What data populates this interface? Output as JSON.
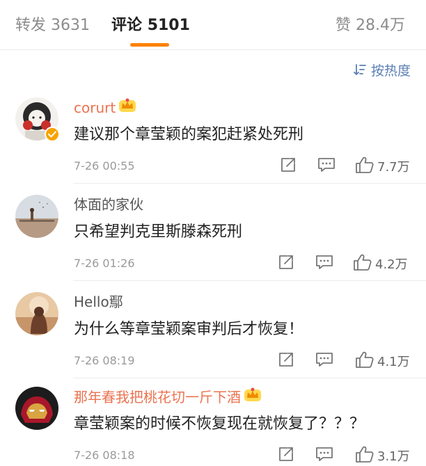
{
  "tabs": {
    "repost": {
      "label": "转发",
      "count": "3631"
    },
    "comments": {
      "label": "评论",
      "count": "5101"
    },
    "likes": {
      "label": "赞",
      "count": "28.4万"
    }
  },
  "sort": {
    "label": "按热度",
    "icon": "sort-icon"
  },
  "colors": {
    "accent": "#ff8200",
    "vip_name": "#eb7350",
    "link": "#5a7fb5"
  },
  "comments": [
    {
      "user": "corurt",
      "vip": true,
      "verified": true,
      "text": "建议那个章莹颖的案犯赶紧处死刑",
      "time": "7-26 00:55",
      "likes": "7.7万"
    },
    {
      "user": "体面的家伙",
      "vip": false,
      "verified": false,
      "text": "只希望判克里斯滕森死刑",
      "time": "7-26 01:26",
      "likes": "4.2万"
    },
    {
      "user": "Hello鄢",
      "vip": false,
      "verified": false,
      "text": "为什么等章莹颖案审判后才恢复！",
      "time": "7-26 08:19",
      "likes": "4.1万"
    },
    {
      "user": "那年春我把桃花切一斤下酒",
      "vip": true,
      "verified": false,
      "text": "章莹颖案的时候不恢复现在就恢复了？？？",
      "time": "7-26 08:18",
      "likes": "3.1万"
    }
  ]
}
